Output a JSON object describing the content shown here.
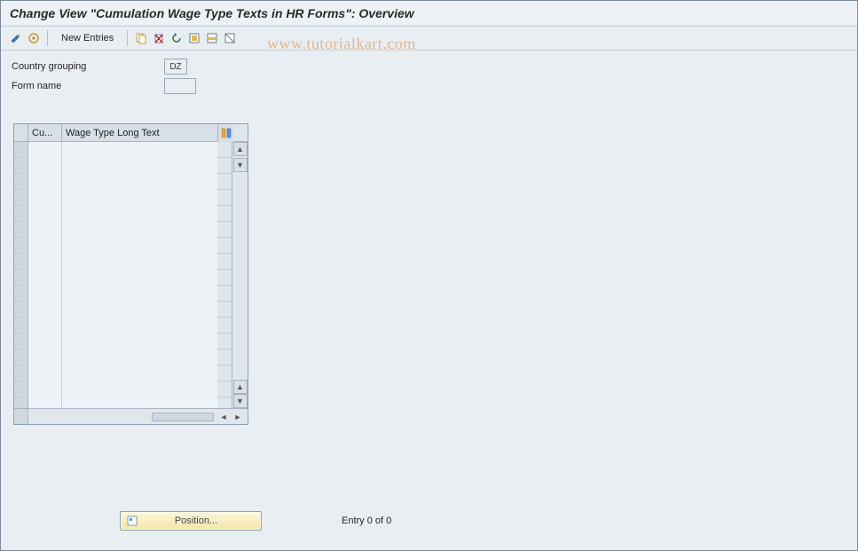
{
  "title": "Change View \"Cumulation Wage Type Texts in HR Forms\": Overview",
  "toolbar": {
    "new_entries_label": "New Entries"
  },
  "watermark": "www.tutorialkart.com",
  "header": {
    "country_label": "Country grouping",
    "country_value": "DZ",
    "form_label": "Form name",
    "form_value": ""
  },
  "table": {
    "col_cu": "Cu...",
    "col_long": "Wage Type Long Text",
    "row_count": 17
  },
  "footer": {
    "position_label": "Position...",
    "entry_text": "Entry 0 of 0"
  }
}
